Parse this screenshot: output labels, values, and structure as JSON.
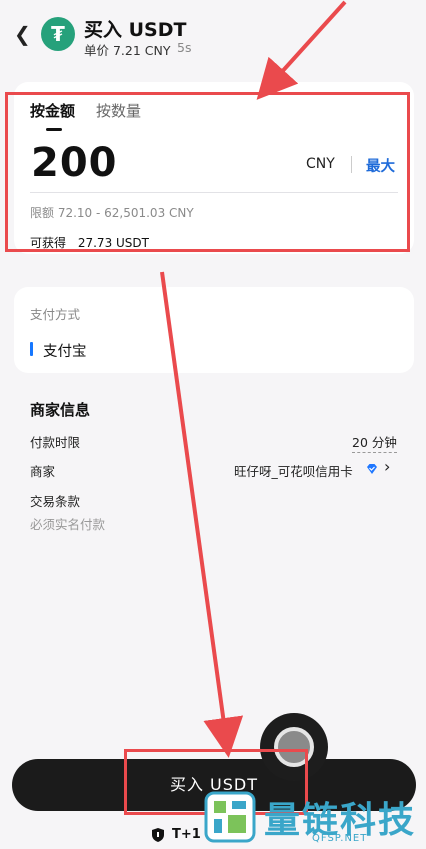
{
  "header": {
    "title": "买入 USDT",
    "unit_price": "单价 7.21 CNY",
    "timer": "5s",
    "coin_symbol": "₮"
  },
  "amount": {
    "tab_amount": "按金额",
    "tab_quantity": "按数量",
    "value": "200",
    "currency": "CNY",
    "max_label": "最大",
    "limit": "限额 72.10 - 62,501.03 CNY",
    "receive_label": "可获得",
    "receive_value": "27.73 USDT"
  },
  "payment": {
    "label": "支付方式",
    "method": "支付宝",
    "accent": "#1677ff"
  },
  "merchant": {
    "title": "商家信息",
    "time_limit_label": "付款时限",
    "time_limit_value": "20 分钟",
    "merchant_label": "商家",
    "merchant_name": "旺仔呀_可花呗信用卡",
    "terms_label": "交易条款",
    "terms_value": "必须实名付款"
  },
  "footer": {
    "buy_label": "买入 USDT",
    "settlement": "T+1"
  },
  "watermark": {
    "text": "量链科技",
    "sub": "QFSP.NET"
  },
  "colors": {
    "annotation": "#ea4a4d",
    "max_link": "#1f6bd9",
    "coin": "#26a17b"
  },
  "icons": [
    "back-arrow-icon",
    "tether-icon",
    "verified-diamond-icon",
    "chevron-right-icon",
    "shield-icon"
  ]
}
